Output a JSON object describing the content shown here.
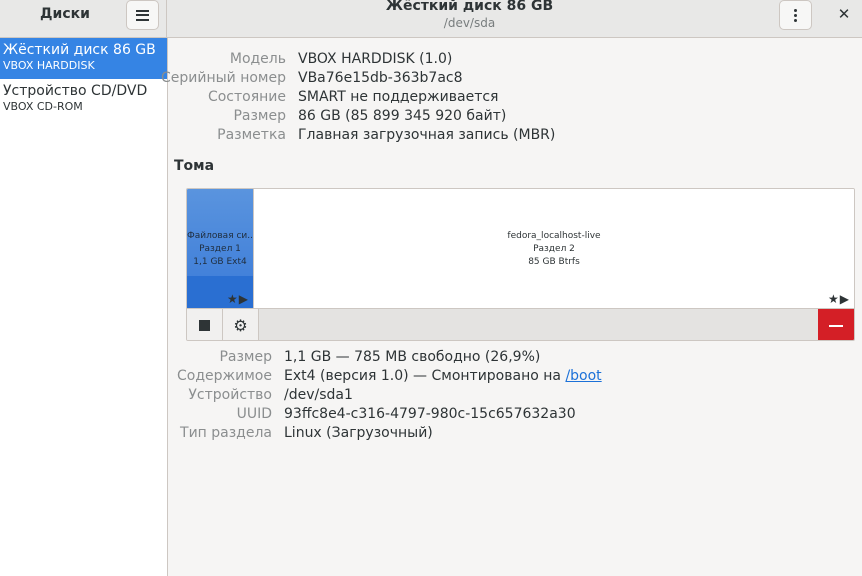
{
  "header": {
    "left_title": "Диски",
    "title": "Жёсткий диск 86 GB",
    "subtitle": "/dev/sda",
    "close_glyph": "✕"
  },
  "sidebar": {
    "items": [
      {
        "name": "Жёсткий диск 86 GB",
        "model": "VBOX HARDDISK",
        "selected": true
      },
      {
        "name": "Устройство CD/DVD",
        "model": "VBOX CD-ROM",
        "selected": false
      }
    ]
  },
  "drive_info": {
    "model_label": "Модель",
    "model": "VBOX HARDDISK (1.0)",
    "serial_label": "Серийный номер",
    "serial": "VBa76e15db-363b7ac8",
    "state_label": "Состояние",
    "state": "SMART не поддерживается",
    "size_label": "Размер",
    "size": "86 GB (85 899 345 920 байт)",
    "partitioning_label": "Разметка",
    "partitioning": "Главная загрузочная запись (MBR)"
  },
  "volumes": {
    "title": "Тома",
    "partitions": [
      {
        "line1": "Файловая си...",
        "line2": "Раздел 1",
        "line3": "1,1 GB Ext4",
        "used_fraction": 0.27
      },
      {
        "line1": "fedora_localhost-live",
        "line2": "Раздел 2",
        "line3": "85 GB Btrfs"
      }
    ],
    "icon_glyphs": "★▶"
  },
  "volume_info": {
    "size_label": "Размер",
    "size": "1,1 GB — 785 MB свободно (26,9%)",
    "contents_label": "Содержимое",
    "contents_prefix": "Ext4 (версия 1.0) — Смонтировано на ",
    "contents_link": "/boot",
    "device_label": "Устройство",
    "device": "/dev/sda1",
    "uuid_label": "UUID",
    "uuid": "93ffc8e4-c316-4797-980c-15c657632a30",
    "parttype_label": "Тип раздела",
    "parttype": "Linux (Загрузочный)"
  },
  "colors": {
    "accent": "#3584e4",
    "destructive": "#d41f26",
    "link": "#1c71d8"
  },
  "icons": [
    "hamburger-menu-icon",
    "kebab-menu-icon",
    "close-icon",
    "star-icon",
    "play-icon",
    "stop-icon",
    "gear-icon",
    "minus-icon"
  ]
}
